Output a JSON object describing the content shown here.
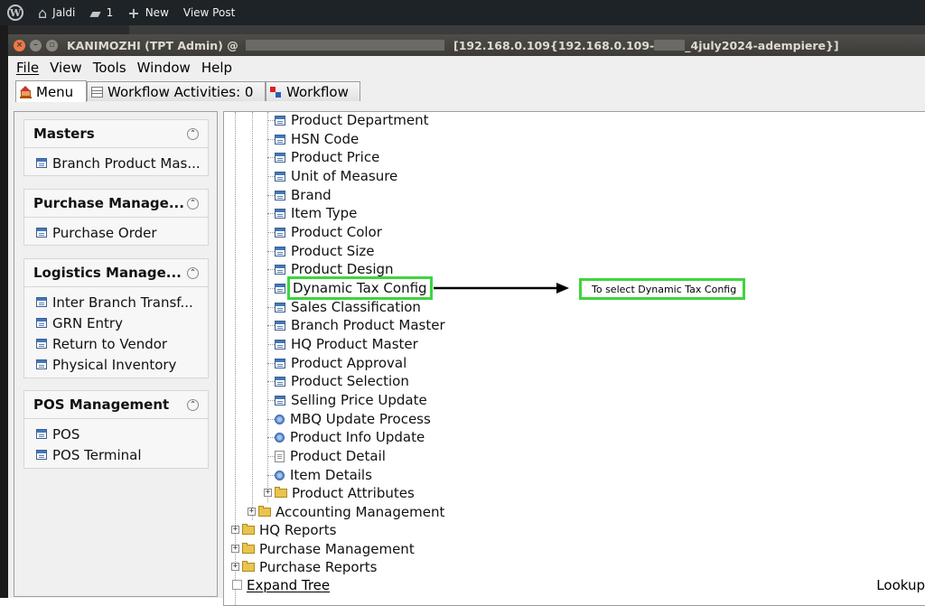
{
  "wp_bar": {
    "site_name": "Jaldi",
    "comments_count": "1",
    "new_label": "New",
    "view_post_label": "View Post"
  },
  "window": {
    "title_user": "KANIMOZHI (TPT Admin) @",
    "title_server": "[192.168.0.109{192.168.0.109-",
    "title_db": "_4july2024-adempiere}]"
  },
  "menubar": {
    "items": [
      "File",
      "View",
      "Tools",
      "Window",
      "Help"
    ]
  },
  "tabs": {
    "menu": "Menu",
    "workflow_activities": "Workflow Activities: 0",
    "workflow": "Workflow"
  },
  "favorites": [
    {
      "title": "Masters",
      "items": [
        "Branch Product Mas..."
      ]
    },
    {
      "title": "Purchase Manage...",
      "items": [
        "Purchase Order"
      ]
    },
    {
      "title": "Logistics Manage...",
      "items": [
        "Inter Branch Transf...",
        "GRN Entry",
        "Return to Vendor",
        "Physical Inventory"
      ]
    },
    {
      "title": "POS Management",
      "items": [
        "POS",
        "POS Terminal"
      ]
    }
  ],
  "tree": {
    "items": [
      {
        "label": "Product Department",
        "icon": "window-icon"
      },
      {
        "label": "HSN Code",
        "icon": "window-icon"
      },
      {
        "label": "Product Price",
        "icon": "window-icon"
      },
      {
        "label": "Unit of Measure",
        "icon": "window-icon"
      },
      {
        "label": "Brand",
        "icon": "window-icon"
      },
      {
        "label": "Item Type",
        "icon": "window-icon"
      },
      {
        "label": "Product Color",
        "icon": "window-icon"
      },
      {
        "label": "Product Size",
        "icon": "window-icon"
      },
      {
        "label": "Product Design",
        "icon": "window-icon"
      },
      {
        "label": "Dynamic Tax Config",
        "icon": "window-icon"
      },
      {
        "label": "Sales Classification",
        "icon": "window-icon"
      },
      {
        "label": "Branch Product Master",
        "icon": "window-icon"
      },
      {
        "label": "HQ Product Master",
        "icon": "window-icon"
      },
      {
        "label": "Product Approval",
        "icon": "window-icon"
      },
      {
        "label": "Product Selection",
        "icon": "window-icon"
      },
      {
        "label": "Selling Price Update",
        "icon": "window-icon"
      },
      {
        "label": "MBQ Update Process",
        "icon": "process-icon"
      },
      {
        "label": "Product Info Update",
        "icon": "process-icon"
      },
      {
        "label": "Product Detail",
        "icon": "document-icon"
      },
      {
        "label": "Item Details",
        "icon": "process-icon"
      },
      {
        "label": "Product Attributes",
        "icon": "folder-icon"
      },
      {
        "label": "Accounting Management",
        "icon": "folder-icon"
      },
      {
        "label": "HQ Reports",
        "icon": "folder-icon"
      },
      {
        "label": "Purchase Management",
        "icon": "folder-icon"
      },
      {
        "label": "Purchase Reports",
        "icon": "folder-icon"
      }
    ],
    "selected_label": "Dynamic Tax Config"
  },
  "annotation": {
    "callout_text": "To select Dynamic Tax Config",
    "highlight_color": "#3fd43f"
  },
  "bottom": {
    "expand_tree_label": "Expand Tree",
    "lookup_label": "Lookup"
  }
}
